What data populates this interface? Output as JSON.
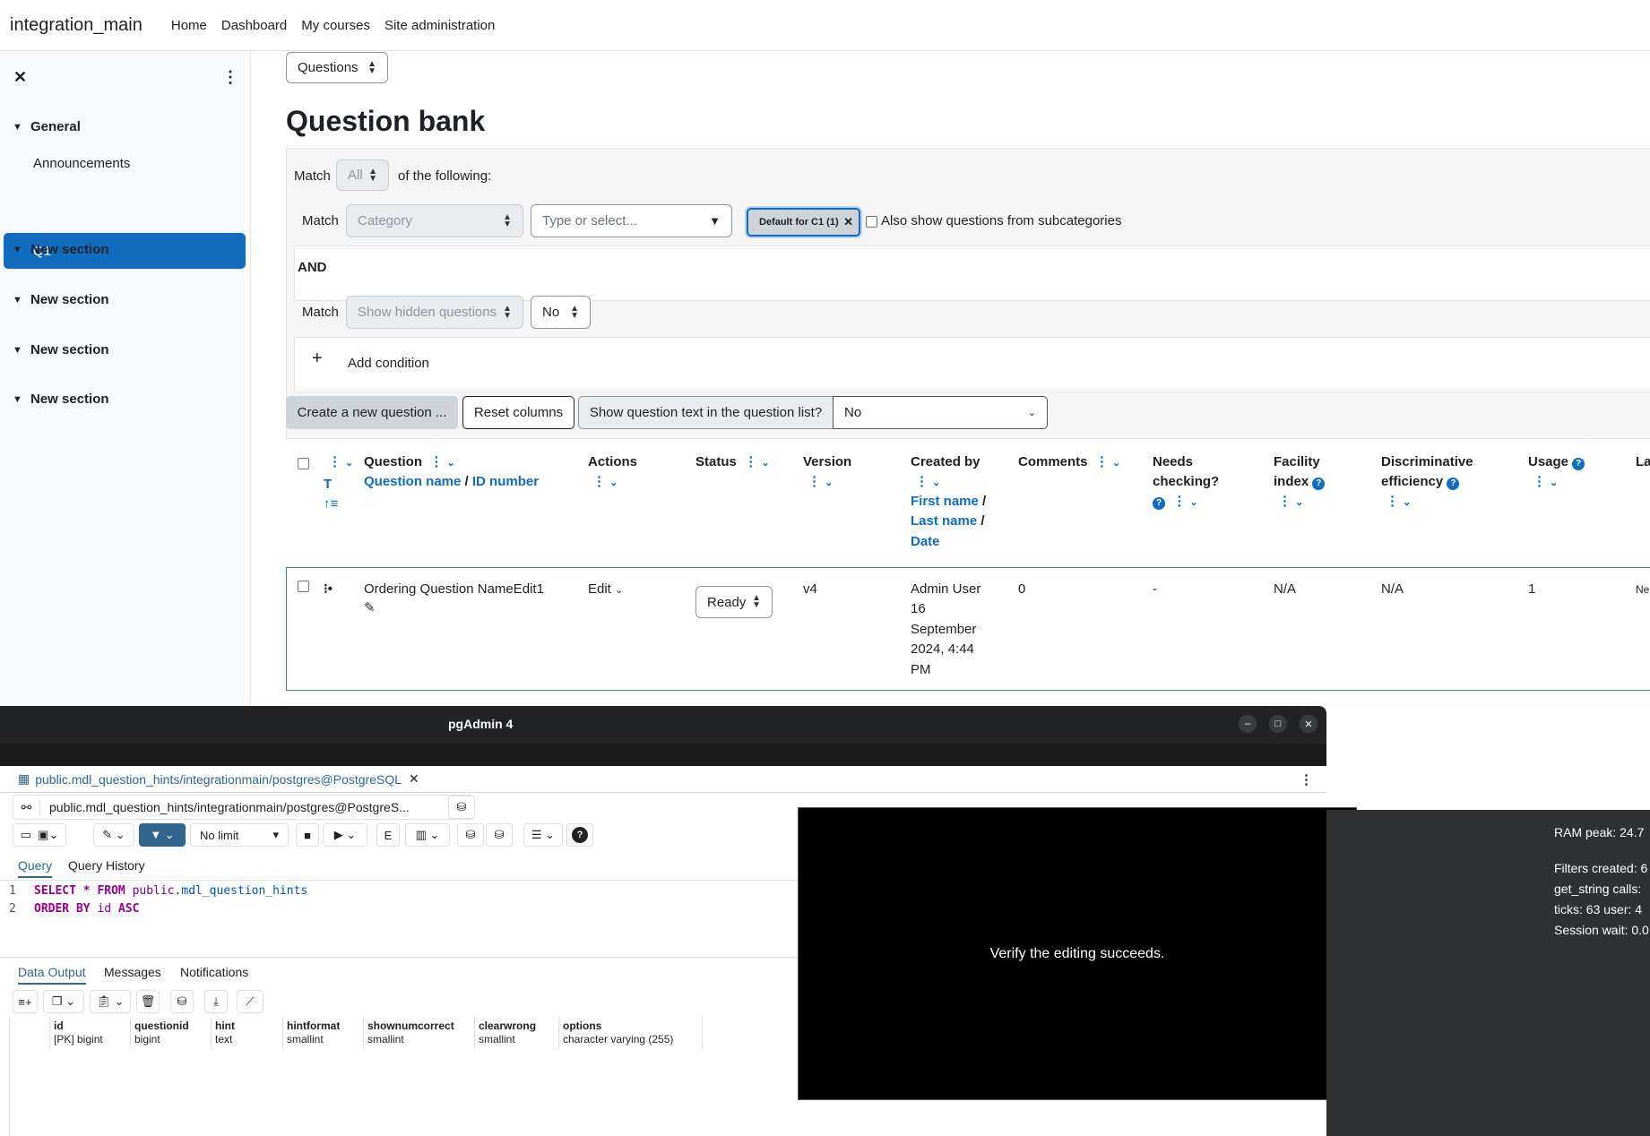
{
  "navbar": {
    "brand": "integration_main",
    "links": [
      "Home",
      "Dashboard",
      "My courses",
      "Site administration"
    ]
  },
  "drawer": {
    "close_glyph": "✕",
    "kebab_glyph": "⋮",
    "sections": [
      "General",
      "New section",
      "New section",
      "New section",
      "New section"
    ],
    "items": [
      "Announcements",
      "Q1"
    ]
  },
  "main": {
    "nav_select": "Questions",
    "title": "Question bank",
    "filter": {
      "match_label": "Match",
      "match_value": "All",
      "of_following": "of the following:",
      "category_placeholder": "Category",
      "type_placeholder": "Type or select...",
      "chip": "Default for C1 (1)",
      "subcat_label": "Also show questions from subcategories",
      "and_label": "AND",
      "hidden_placeholder": "Show hidden questions",
      "hidden_value": "No",
      "add_condition": "Add condition"
    },
    "buttons": {
      "create": "Create a new question ...",
      "reset": "Reset columns",
      "show_text": "Show question text in the question list?",
      "show_text_value": "No"
    },
    "table": {
      "headers": {
        "t": "T",
        "question": "Question",
        "question_name": "Question name",
        "id_number": "ID number",
        "actions": "Actions",
        "status": "Status",
        "version": "Version",
        "created_by": "Created by",
        "first_name": "First name",
        "last_name": "Last name",
        "date": "Date",
        "comments": "Comments",
        "needs1": "Needs",
        "needs2": "checking?",
        "facility1": "Facility",
        "facility2": "index",
        "disc1": "Discriminative",
        "disc2": "efficiency",
        "usage": "Usage",
        "last": "La"
      },
      "row": {
        "name": "Ordering Question NameEdit1",
        "action": "Edit",
        "status": "Ready",
        "version": "v4",
        "created1": "Admin User",
        "created2": "16",
        "created3": "September",
        "created4": "2024, 4:44",
        "created5": "PM",
        "comments": "0",
        "needs": "-",
        "facility": "N/A",
        "disc": "N/A",
        "usage": "1",
        "last": "Ne"
      }
    }
  },
  "pgadmin": {
    "title": "pgAdmin 4",
    "tab": "public.mdl_question_hints/integrationmain/postgres@PostgreSQL",
    "address": "public.mdl_question_hints/integrationmain/postgres@PostgreS...",
    "limit": "No limit",
    "subtabs": [
      "Query",
      "Query History"
    ],
    "code": {
      "l1_n": "1",
      "l1_kw": "SELECT * FROM",
      "l1_sch": "public",
      "l1_tbl": "mdl_question_hints",
      "l2_n": "2",
      "l2_kw1": "ORDER BY",
      "l2_col": "id",
      "l2_kw2": "ASC"
    },
    "output_tabs": [
      "Data Output",
      "Messages",
      "Notifications"
    ],
    "columns": [
      {
        "name": "id",
        "type": "[PK] bigint"
      },
      {
        "name": "questionid",
        "type": "bigint"
      },
      {
        "name": "hint",
        "type": "text"
      },
      {
        "name": "hintformat",
        "type": "smallint"
      },
      {
        "name": "shownumcorrect",
        "type": "smallint"
      },
      {
        "name": "clearwrong",
        "type": "smallint"
      },
      {
        "name": "options",
        "type": "character varying (255)"
      }
    ]
  },
  "overlay": {
    "message": "Verify the editing succeeds."
  },
  "perf": {
    "ram": "RAM peak: 24.7",
    "filters": "Filters created: 6",
    "getstring": "get_string calls:",
    "ticks": "ticks: 63 user: 4",
    "session": "Session wait: 0.0"
  }
}
